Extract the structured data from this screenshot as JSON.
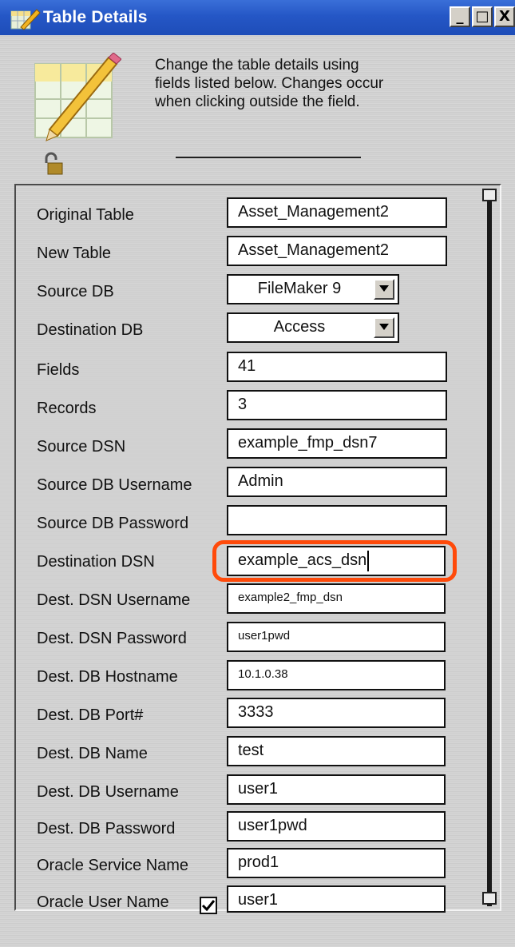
{
  "window": {
    "title": "Table Details",
    "buttons": {
      "minimize": "_",
      "maximize": "□",
      "close": "X"
    }
  },
  "header": {
    "description": "Change the table details using fields listed below. Changes occur when clicking outside the field.",
    "icon": "table-edit-icon",
    "lock_icon": "unlocked-padlock-icon"
  },
  "fields": {
    "original_table": {
      "label": "Original Table",
      "value": "Asset_Management2"
    },
    "new_table": {
      "label": "New Table",
      "value": "Asset_Management2"
    },
    "source_db": {
      "label": "Source DB",
      "value": "FileMaker 9"
    },
    "destination_db": {
      "label": "Destination DB",
      "value": "Access"
    },
    "fields_count": {
      "label": "Fields",
      "value": "41"
    },
    "records": {
      "label": "Records",
      "value": "3"
    },
    "source_dsn": {
      "label": "Source DSN",
      "value": "example_fmp_dsn7"
    },
    "source_db_username": {
      "label": "Source DB Username",
      "value": "Admin"
    },
    "source_db_password": {
      "label": "Source DB Password",
      "value": ""
    },
    "destination_dsn": {
      "label": "Destination DSN",
      "value": "example_acs_dsn"
    },
    "dest_dsn_username": {
      "label": "Dest. DSN Username",
      "value": "example2_fmp_dsn"
    },
    "dest_dsn_password": {
      "label": "Dest. DSN Password",
      "value": "user1pwd"
    },
    "dest_db_hostname": {
      "label": "Dest. DB Hostname",
      "value": "10.1.0.38"
    },
    "dest_db_port": {
      "label": "Dest. DB Port#",
      "value": "3333"
    },
    "dest_db_name": {
      "label": "Dest. DB Name",
      "value": "test"
    },
    "dest_db_username": {
      "label": "Dest. DB Username",
      "value": "user1"
    },
    "dest_db_password": {
      "label": "Dest. DB Password",
      "value": "user1pwd"
    },
    "oracle_service_name": {
      "label": "Oracle Service Name",
      "value": "prod1"
    },
    "oracle_user_name": {
      "label": "Oracle User Name",
      "value": "user1",
      "checked": true
    }
  },
  "colors": {
    "titlebar": "#2557c6",
    "highlight": "#ff4a0a"
  }
}
